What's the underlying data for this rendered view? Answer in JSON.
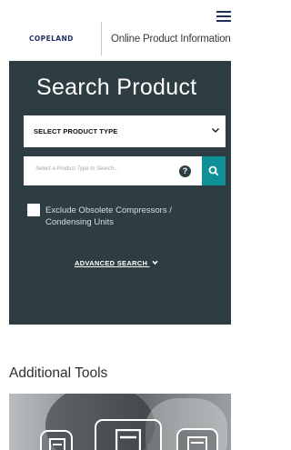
{
  "header": {
    "logo_text": "COPELAND",
    "title": "Online Product Information",
    "menu_icon": "hamburger-menu-icon"
  },
  "search": {
    "heading": "Search Product",
    "select_label": "SELECT PRODUCT TYPE",
    "input_placeholder": "Select a Product Type to Search...",
    "input_value": "",
    "help_icon": "question-circle-icon",
    "help_glyph": "?",
    "search_icon": "magnifier-icon",
    "exclude_checked": false,
    "exclude_label": "Exclude Obsolete Compressors / Condensing Units",
    "advanced_label": "ADVANCED SEARCH",
    "advanced_icon": "chevron-down-icon"
  },
  "tools": {
    "heading": "Additional Tools",
    "tool_icons": [
      "document-icon",
      "document-icon",
      "document-icon"
    ]
  },
  "colors": {
    "brand_navy": "#1f2f5c",
    "panel_dark": "#2e3d42",
    "accent_teal": "#0f8f96",
    "background": "#ffffff"
  }
}
